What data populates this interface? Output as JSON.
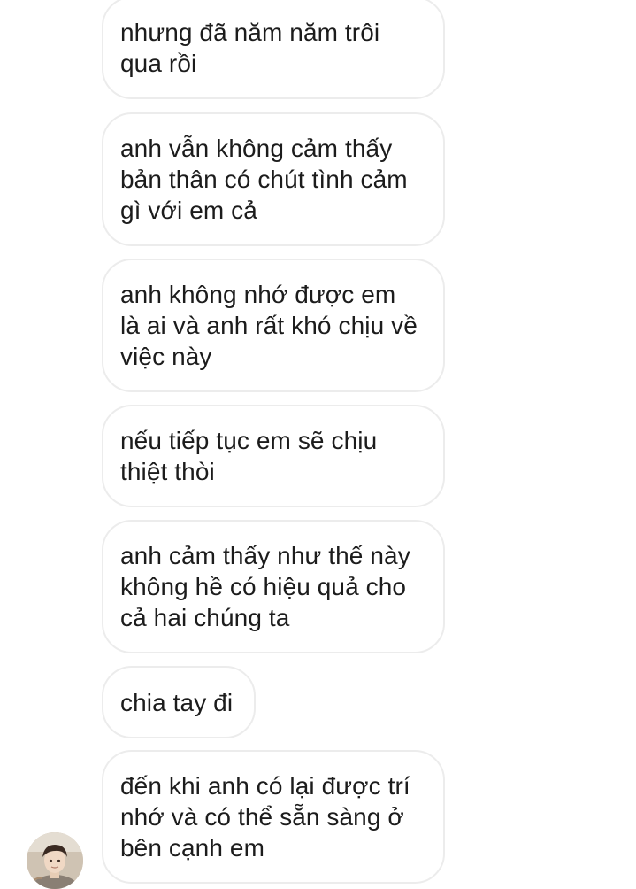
{
  "conversation": {
    "messages": [
      {
        "text": "nhưng đã năm năm trôi\nqua rồi"
      },
      {
        "text": "anh vẫn không cảm thấy\nbản thân có chút tình cảm\ngì với em cả"
      },
      {
        "text": "anh không nhớ được em\nlà ai và anh rất khó chịu về\nviệc này"
      },
      {
        "text": "nếu tiếp tục em sẽ chịu\nthiệt thòi"
      },
      {
        "text": "anh cảm thấy như thế này\nkhông hề có hiệu quả cho\ncả hai chúng ta"
      },
      {
        "text": "chia tay đi"
      },
      {
        "text": "đến khi anh có lại được trí\nnhớ và có thể sẵn sàng ở\nbên cạnh em"
      }
    ],
    "sender_avatar": {
      "icon": "profile-photo"
    }
  },
  "colors": {
    "bubble_border": "#ececec",
    "text": "#1c1c1c",
    "background": "#ffffff"
  }
}
